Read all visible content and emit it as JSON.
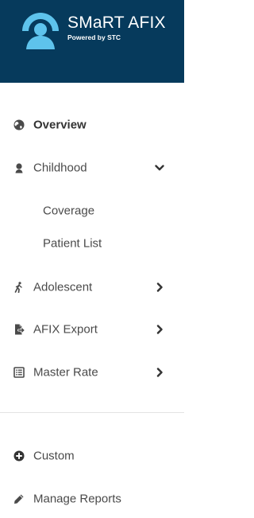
{
  "header": {
    "title": "SMaRT AFIX",
    "subtitle": "Powered by STC",
    "logo_icon": "user-circle-logo-icon",
    "background": "#063a5c",
    "logo_accent": "#5ec3ec"
  },
  "nav": {
    "overview": {
      "label": "Overview",
      "icon": "globe-icon"
    },
    "childhood": {
      "label": "Childhood",
      "icon": "baby-icon",
      "expanded": true,
      "children": {
        "coverage": "Coverage",
        "patient_list": "Patient List"
      }
    },
    "adolescent": {
      "label": "Adolescent",
      "icon": "walking-icon"
    },
    "afix_export": {
      "label": "AFIX Export",
      "icon": "file-export-icon"
    },
    "master_rate": {
      "label": "Master Rate",
      "icon": "list-alt-icon"
    },
    "custom": {
      "label": "Custom",
      "icon": "plus-circle-icon"
    },
    "manage_reports": {
      "label": "Manage Reports",
      "icon": "pencil-icon"
    }
  }
}
